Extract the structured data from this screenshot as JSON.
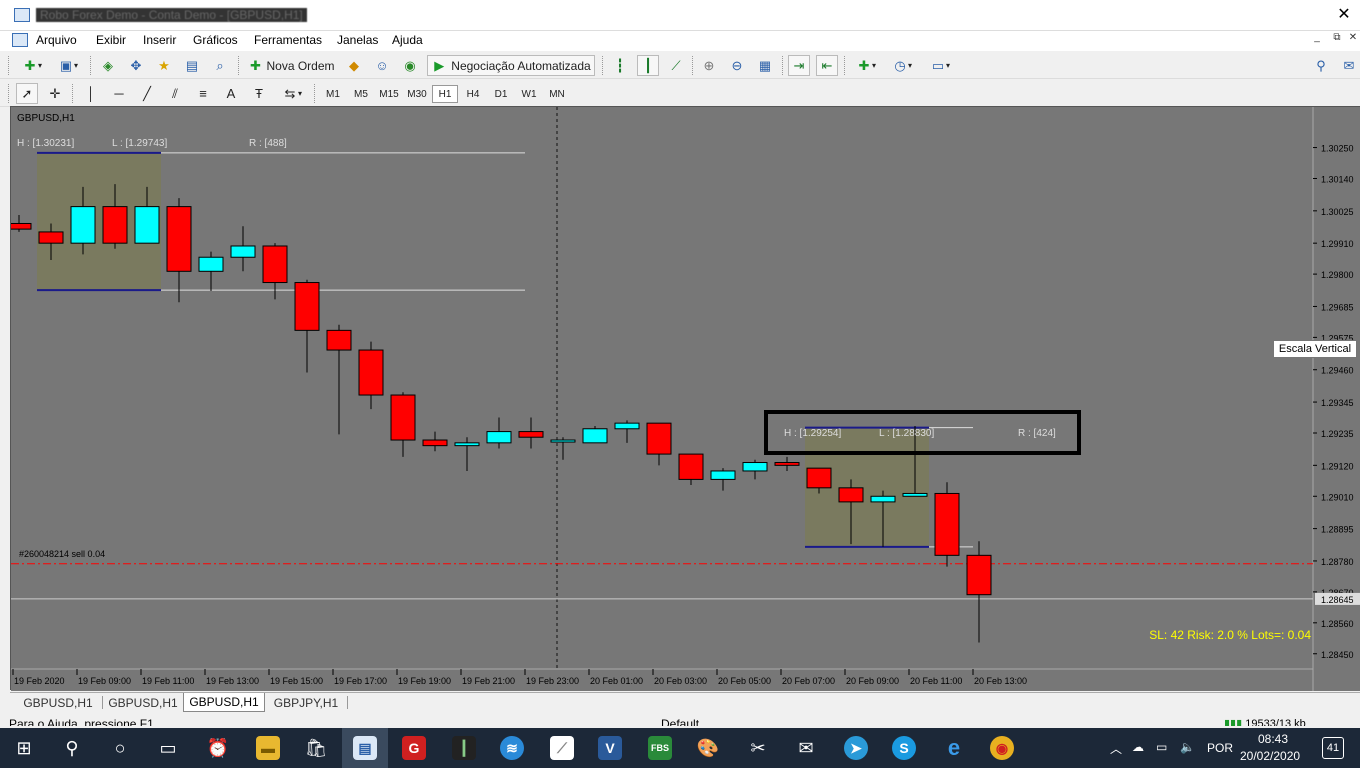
{
  "window": {
    "title": "Robo Forex Demo - Conta Demo - [GBPUSD,H1]",
    "close_label": "✕"
  },
  "menu": {
    "items": [
      "Arquivo",
      "Exibir",
      "Inserir",
      "Gráficos",
      "Ferramentas",
      "Janelas",
      "Ajuda"
    ],
    "minimize": "_",
    "restore": "⧉",
    "close": "✕"
  },
  "toolbar": {
    "new_order": "Nova Ordem",
    "auto_trading": "Negociação Automatizada"
  },
  "timeframes": [
    "M1",
    "M5",
    "M15",
    "M30",
    "H1",
    "H4",
    "D1",
    "W1",
    "MN"
  ],
  "active_timeframe": "H1",
  "chart": {
    "symbol_label": "GBPUSD,H1",
    "box1": {
      "h": "H : [1.30231]",
      "l": "L : [1.29743]",
      "r": "R : [488]"
    },
    "box2": {
      "h": "H : [1.29254]",
      "l": "L : [1.28830]",
      "r": "R : [424]"
    },
    "order_label": "#260048214 sell 0.04",
    "info": "SL: 42  Risk: 2.0 %  Lots=: 0.04",
    "current_price": "1.28645",
    "tooltip": "Escala Vertical"
  },
  "chart_data": {
    "type": "candlestick",
    "price_axis": [
      "1.30250",
      "1.30140",
      "1.30025",
      "1.29910",
      "1.29800",
      "1.29685",
      "1.29575",
      "1.29460",
      "1.29345",
      "1.29235",
      "1.29120",
      "1.29010",
      "1.28895",
      "1.28780",
      "1.28670",
      "1.28645",
      "1.28560",
      "1.28450"
    ],
    "time_axis": [
      "19 Feb 2020",
      "19 Feb 09:00",
      "19 Feb 11:00",
      "19 Feb 13:00",
      "19 Feb 15:00",
      "19 Feb 17:00",
      "19 Feb 19:00",
      "19 Feb 21:00",
      "19 Feb 23:00",
      "20 Feb 01:00",
      "20 Feb 03:00",
      "20 Feb 05:00",
      "20 Feb 07:00",
      "20 Feb 09:00",
      "20 Feb 11:00",
      "20 Feb 13:00"
    ],
    "ylim": [
      1.2841,
      1.3038
    ],
    "candles": [
      {
        "o": 1.2998,
        "h": 1.3001,
        "l": 1.2995,
        "c": 1.2996
      },
      {
        "o": 1.2995,
        "h": 1.2998,
        "l": 1.2985,
        "c": 1.2991
      },
      {
        "o": 1.2991,
        "h": 1.3011,
        "l": 1.2987,
        "c": 1.3004
      },
      {
        "o": 1.3004,
        "h": 1.3012,
        "l": 1.2989,
        "c": 1.2991
      },
      {
        "o": 1.2991,
        "h": 1.3011,
        "l": 1.2991,
        "c": 1.3004
      },
      {
        "o": 1.3004,
        "h": 1.3007,
        "l": 1.297,
        "c": 1.2981
      },
      {
        "o": 1.2981,
        "h": 1.2988,
        "l": 1.2974,
        "c": 1.2986
      },
      {
        "o": 1.2986,
        "h": 1.2997,
        "l": 1.2981,
        "c": 1.299
      },
      {
        "o": 1.299,
        "h": 1.2991,
        "l": 1.2971,
        "c": 1.2977
      },
      {
        "o": 1.2977,
        "h": 1.2978,
        "l": 1.2945,
        "c": 1.296
      },
      {
        "o": 1.296,
        "h": 1.2962,
        "l": 1.2923,
        "c": 1.2953
      },
      {
        "o": 1.2953,
        "h": 1.2956,
        "l": 1.2932,
        "c": 1.2937
      },
      {
        "o": 1.2937,
        "h": 1.2938,
        "l": 1.2915,
        "c": 1.2921
      },
      {
        "o": 1.2921,
        "h": 1.2924,
        "l": 1.2917,
        "c": 1.2919
      },
      {
        "o": 1.2919,
        "h": 1.2922,
        "l": 1.291,
        "c": 1.292
      },
      {
        "o": 1.292,
        "h": 1.2929,
        "l": 1.2918,
        "c": 1.2924
      },
      {
        "o": 1.2924,
        "h": 1.2929,
        "l": 1.2918,
        "c": 1.2922
      },
      {
        "o": 1.2921,
        "h": 1.2922,
        "l": 1.2914,
        "c": 1.2921
      },
      {
        "o": 1.292,
        "h": 1.2926,
        "l": 1.292,
        "c": 1.2925
      },
      {
        "o": 1.2925,
        "h": 1.2928,
        "l": 1.292,
        "c": 1.2927
      },
      {
        "o": 1.2927,
        "h": 1.2927,
        "l": 1.2912,
        "c": 1.2916
      },
      {
        "o": 1.2916,
        "h": 1.2916,
        "l": 1.2905,
        "c": 1.2907
      },
      {
        "o": 1.2907,
        "h": 1.2911,
        "l": 1.2903,
        "c": 1.291
      },
      {
        "o": 1.291,
        "h": 1.2914,
        "l": 1.2907,
        "c": 1.2913
      },
      {
        "o": 1.2913,
        "h": 1.2915,
        "l": 1.291,
        "c": 1.2912
      },
      {
        "o": 1.2911,
        "h": 1.2911,
        "l": 1.2902,
        "c": 1.2904
      },
      {
        "o": 1.2904,
        "h": 1.2907,
        "l": 1.2884,
        "c": 1.2899
      },
      {
        "o": 1.2899,
        "h": 1.2903,
        "l": 1.2883,
        "c": 1.2901
      },
      {
        "o": 1.2901,
        "h": 1.2926,
        "l": 1.2901,
        "c": 1.2902
      },
      {
        "o": 1.2902,
        "h": 1.2906,
        "l": 1.2876,
        "c": 1.288
      },
      {
        "o": 1.288,
        "h": 1.2885,
        "l": 1.2849,
        "c": 1.2866
      }
    ]
  },
  "tabs": [
    "GBPUSD,H1",
    "GBPUSD,H1",
    "GBPUSD,H1",
    "GBPJPY,H1"
  ],
  "active_tab": 2,
  "status": {
    "help": "Para o Ajuda, pressione F1",
    "profile": "Default",
    "traffic": "19533/13 kb"
  },
  "tray": {
    "lang": "POR",
    "time": "08:43",
    "date": "20/02/2020",
    "notif": "41"
  },
  "colors": {
    "bull": "#00ffff",
    "bear": "#ff0000",
    "chart_bg": "#777777",
    "box_fill": "#7a7a5a"
  }
}
